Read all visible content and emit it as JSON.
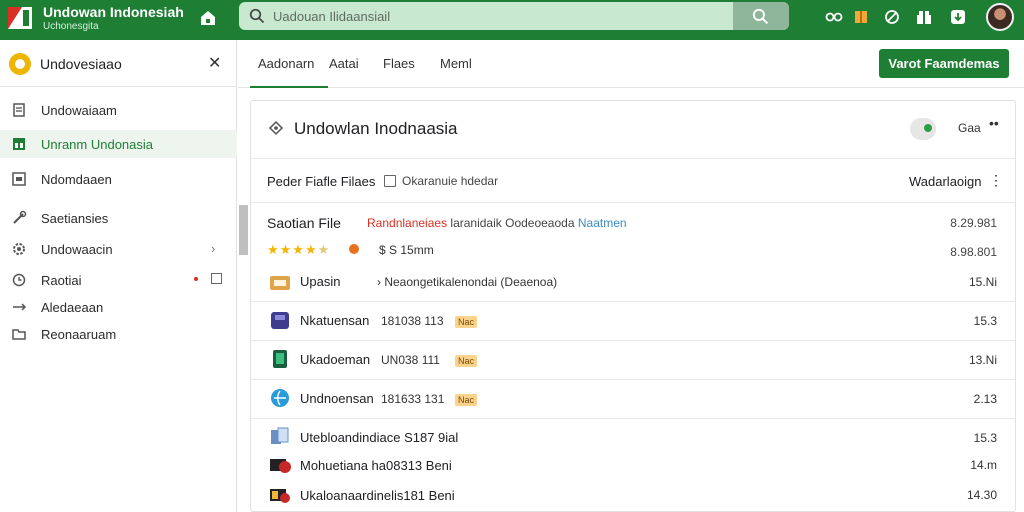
{
  "header": {
    "title": "Undowan Indonesiah",
    "subtitle": "Uchonesgita",
    "search_placeholder": "Uadouan Ilidaansiail",
    "icons": [
      "home-icon",
      "search-icon",
      "share-icon",
      "package-icon",
      "edit-icon",
      "gift-icon",
      "download-icon",
      "avatar"
    ]
  },
  "sidebar": {
    "header_label": "Undovesiaao",
    "items": [
      {
        "label": "Undowaiaam",
        "icon": "document-icon"
      },
      {
        "label": "Unranm Undonasia",
        "icon": "apps-icon",
        "active": true
      },
      {
        "label": "Ndomdaaen",
        "icon": "image-icon"
      },
      {
        "label": "Saetiansies",
        "icon": "tools-icon"
      },
      {
        "label": "Undowaacin",
        "icon": "settings-icon"
      },
      {
        "label": "Raotiai",
        "icon": "clock-icon"
      },
      {
        "label": "Aledaeaan",
        "icon": "arrow-icon"
      },
      {
        "label": "Reonaaruam",
        "icon": "folder-icon"
      }
    ]
  },
  "tabs": [
    "Aadonarn",
    "Aatai",
    "Flaes",
    "Meml"
  ],
  "primary_button": "Varot Faamdemas",
  "card": {
    "title": "Undowlan Inodnaasia",
    "meta": "Gaa",
    "filter_label": "Peder Fiafle Filaes",
    "filter_text": "Okaranuie hdedar",
    "sort_label": "Wadarlaoign",
    "section": {
      "title": "Saotian File",
      "tag_red": "Randnlaneiaes",
      "tag_gray": "laranidaik Oodeoeaoda",
      "tag_blue": "Naatmen",
      "value1": "8.29.981",
      "value2": "8.98.801",
      "price": "$ S 15mm"
    },
    "rows": [
      {
        "name": "Upasin",
        "desc": "Neaongetikalenondai (Deaenoa)",
        "num": "15.Ni"
      },
      {
        "name": "Nkatuensan",
        "code": "181038 113",
        "badge": "Nac",
        "num": "15.3"
      },
      {
        "name": "Ukadoeman",
        "code": "UN038 111",
        "badge": "Nac",
        "num": "13.Ni"
      },
      {
        "name": "Undnoensan",
        "code": "181633 131",
        "badge": "Nac",
        "num": "2.13"
      },
      {
        "name": "Utebloandindiace S187 9ial",
        "num": "15.3"
      },
      {
        "name": "Mohuetiana ha08313 Beni",
        "num": "14.m"
      },
      {
        "name": "Ukaloanaardinelis181 Beni",
        "num": "14.30"
      }
    ]
  },
  "colors": {
    "brand": "#1e7e34",
    "search_bg": "#c9e8d0",
    "active_bg": "#eef5ef",
    "tag_red": "#d93025",
    "tag_blue": "#3b8bc4",
    "star": "#f4b400"
  }
}
